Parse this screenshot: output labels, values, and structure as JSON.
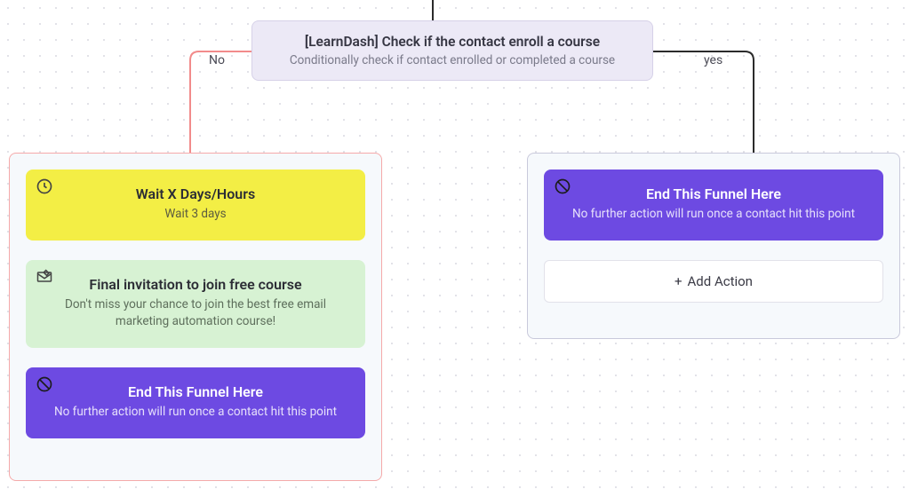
{
  "condition": {
    "title": "[LearnDash] Check if the contact enroll a course",
    "subtitle": "Conditionally check if contact enrolled or completed a course"
  },
  "branches": {
    "no": "No",
    "yes": "yes"
  },
  "left": {
    "wait": {
      "title": "Wait X Days/Hours",
      "sub": "Wait 3 days"
    },
    "email": {
      "title": "Final invitation to join free course",
      "sub": "Don't miss your chance to join the best free email marketing automation course!"
    },
    "end": {
      "title": "End This Funnel Here",
      "sub": "No further action will run once a contact hit this point"
    }
  },
  "right": {
    "end": {
      "title": "End This Funnel Here",
      "sub": "No further action will run once a contact hit this point"
    },
    "addAction": "Add Action"
  }
}
